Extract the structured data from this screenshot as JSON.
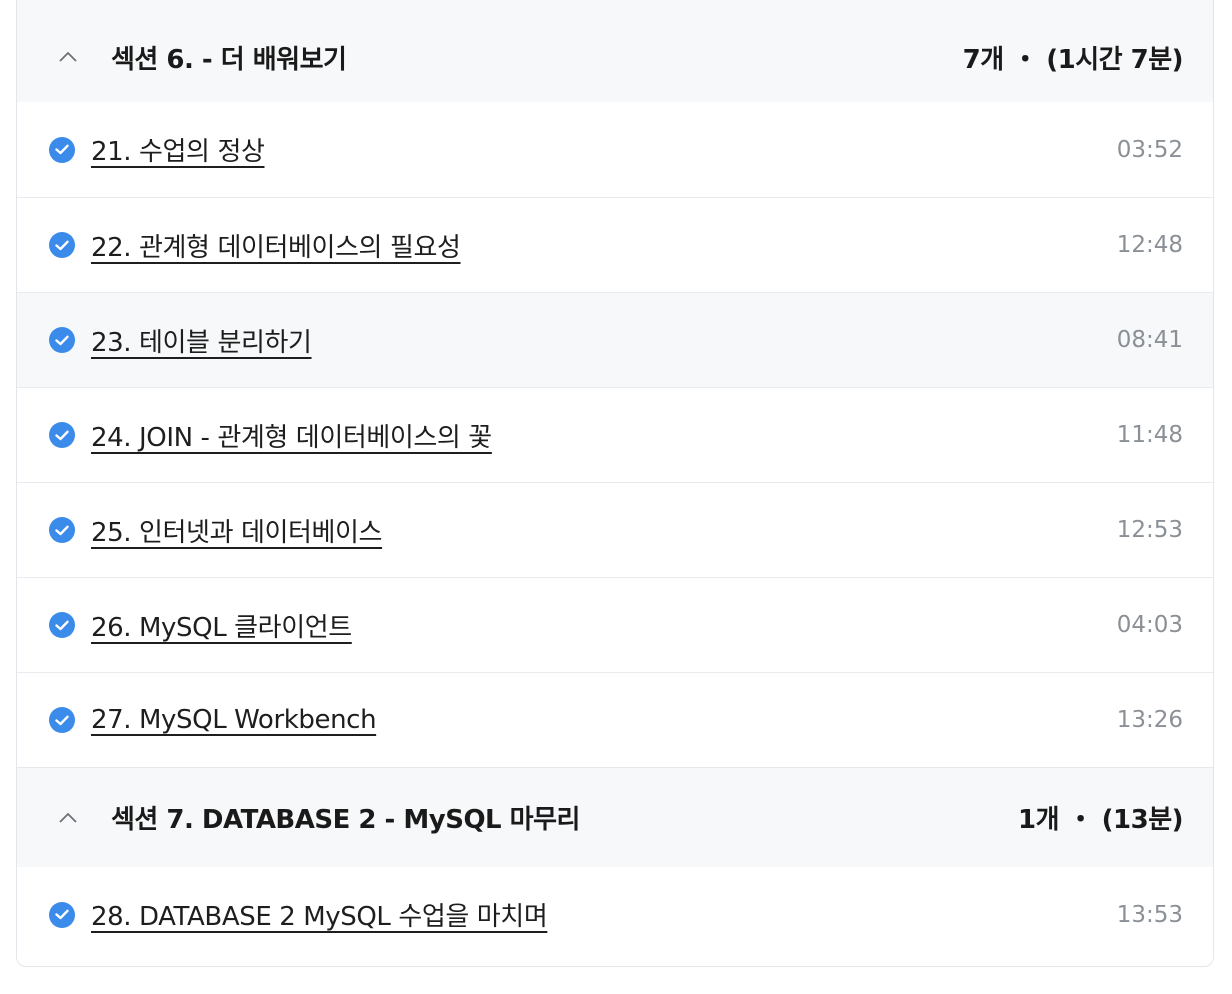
{
  "sections": [
    {
      "title": "섹션 6. - 더 배워보기",
      "meta": "7개 ・ (1시간 7분)",
      "lessons": [
        {
          "title": "21. 수업의 정상",
          "time": "03:52"
        },
        {
          "title": "22. 관계형 데이터베이스의 필요성",
          "time": "12:48"
        },
        {
          "title": "23. 테이블 분리하기",
          "time": "08:41"
        },
        {
          "title": "24. JOIN - 관계형 데이터베이스의 꽃",
          "time": "11:48"
        },
        {
          "title": "25. 인터넷과 데이터베이스",
          "time": "12:53"
        },
        {
          "title": "26. MySQL 클라이언트",
          "time": "04:03"
        },
        {
          "title": "27. MySQL Workbench",
          "time": "13:26"
        }
      ]
    },
    {
      "title": "섹션 7. DATABASE 2 - MySQL 마무리",
      "meta": "1개 ・ (13분)",
      "lessons": [
        {
          "title": "28. DATABASE 2 MySQL 수업을 마치며",
          "time": "13:53"
        }
      ]
    }
  ],
  "colors": {
    "check": "#3b8beb",
    "header_bg": "#f7f8f9"
  },
  "icons": {
    "section_toggle": "chevron-up-icon",
    "lesson_status": "check-circle-icon"
  }
}
